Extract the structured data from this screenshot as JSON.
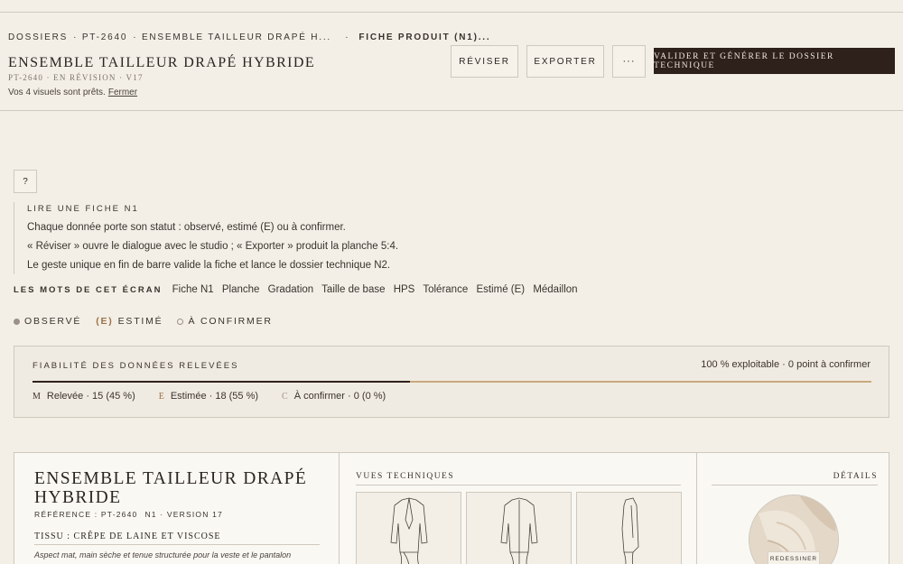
{
  "header": {
    "breadcrumb": [
      "DOSSIERS",
      "PT-2640",
      "ENSEMBLE TAILLEUR DRAPÉ H...",
      "FICHE PRODUIT (N1)..."
    ],
    "title": "ENSEMBLE TAILLEUR DRAPÉ HYBRIDE",
    "subtitle": "PT-2640 · EN RÉVISION · V17",
    "notice_text": "Vos 4 visuels sont prêts.",
    "notice_close": "Fermer",
    "buttons": {
      "revise": "RÉVISER",
      "export": "EXPORTER",
      "more": "···",
      "primary": "VALIDER ET GÉNÉRER LE DOSSIER TECHNIQUE"
    }
  },
  "help": {
    "button": "?",
    "title": "LIRE UNE FICHE N1",
    "lines": [
      "Chaque donnée porte son statut : observé, estimé (E) ou à confirmer.",
      "« Réviser » ouvre le dialogue avec le studio ; « Exporter » produit la planche 5:4.",
      "Le geste unique en fin de barre valide la fiche et lance le dossier technique N2."
    ]
  },
  "glossary": {
    "label": "LES MOTS DE CET ÉCRAN",
    "terms": [
      "Fiche N1",
      "Planche",
      "Gradation",
      "Taille de base",
      "HPS",
      "Tolérance",
      "Estimé (E)",
      "Médaillon"
    ]
  },
  "legend": {
    "observed": "OBSERVÉ",
    "estimated_mark": "(E)",
    "estimated": "ESTIMÉ",
    "to_confirm": "À CONFIRMER"
  },
  "reliability": {
    "title": "FIABILITÉ DES DONNÉES RELEVÉES",
    "summary": "100 % exploitable · 0 point à confirmer",
    "observed_share": 0.45,
    "stats": [
      {
        "mark": "M",
        "text": "Relevée · 15 (45 %)"
      },
      {
        "mark": "E",
        "text": "Estimée · 18 (55 %)"
      },
      {
        "mark": "C",
        "text": "À confirmer · 0 (0 %)"
      }
    ]
  },
  "product": {
    "title": "ENSEMBLE TAILLEUR DRAPÉ HYBRIDE",
    "reference": "RÉFÉRENCE : PT-2640",
    "level": "N1 · VERSION 17",
    "fabric": "TISSU : CRÊPE DE LAINE ET VISCOSE",
    "description": "Aspect mat, main sèche et tenue structurée pour la veste et le pantalon",
    "views_title": "VUES TECHNIQUES",
    "details_title": "DÉTAILS",
    "redesign": "REDESSINER"
  },
  "colors": {
    "background": "#f3efe7",
    "primary_button": "#2e201b",
    "estimate_accent": "#9a7248",
    "border": "#cfc8bd"
  }
}
